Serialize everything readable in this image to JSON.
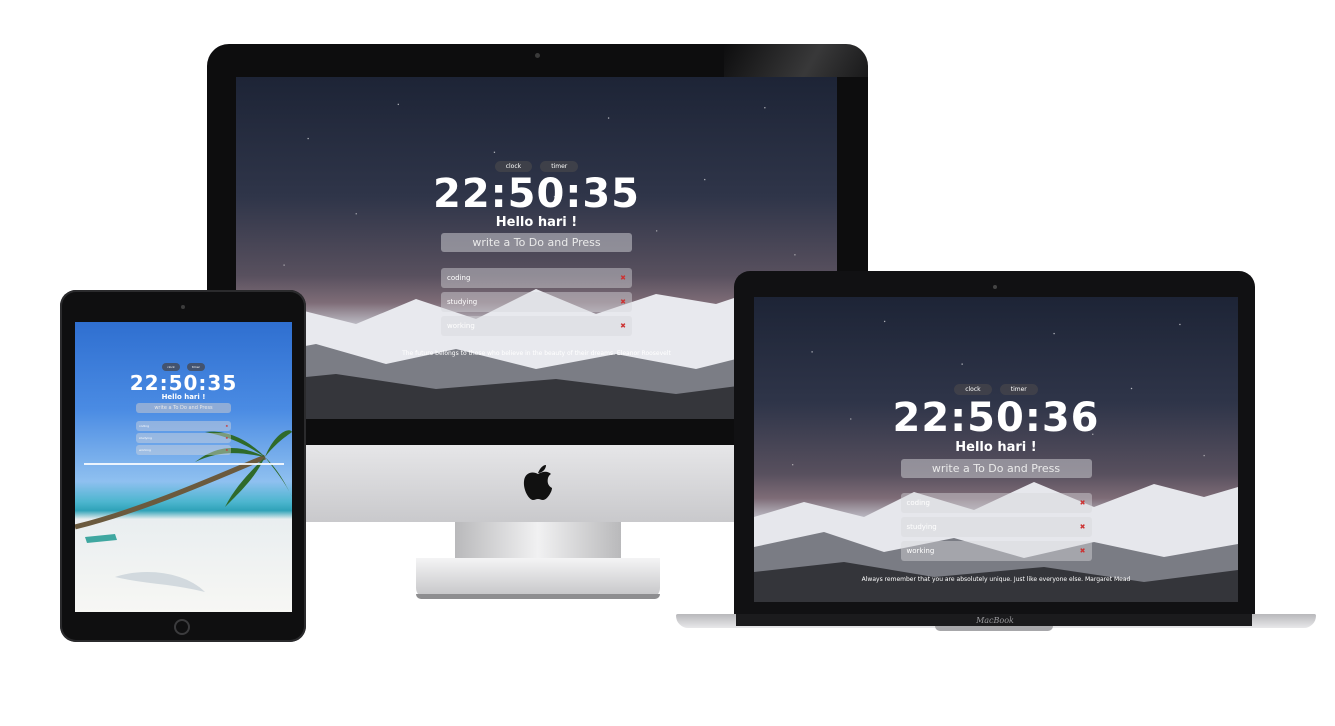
{
  "imac": {
    "toggle": {
      "clock_label": "clock",
      "timer_label": "timer"
    },
    "time": "22:50:35",
    "greeting": "Hello hari !",
    "input_placeholder": "write a To Do and Press",
    "todos": [
      {
        "text": "coding",
        "delete": "✖"
      },
      {
        "text": "studying",
        "delete": "✖"
      },
      {
        "text": "working",
        "delete": "✖"
      }
    ],
    "quote": "The future belongs to those who believe in the beauty of their dreams. Eleanor Roosevelt",
    "logo": ""
  },
  "laptop": {
    "toggle": {
      "clock_label": "clock",
      "timer_label": "timer"
    },
    "time": "22:50:36",
    "greeting": "Hello hari !",
    "input_placeholder": "write a To Do and Press",
    "todos": [
      {
        "text": "coding",
        "delete": "✖"
      },
      {
        "text": "studying",
        "delete": "✖"
      },
      {
        "text": "working",
        "delete": "✖"
      }
    ],
    "quote": "Always remember that you are absolutely unique. Just like everyone else. Margaret Mead",
    "brand": "MacBook"
  },
  "ipad": {
    "toggle": {
      "clock_label": "clock",
      "timer_label": "timer"
    },
    "time": "22:50:35",
    "greeting": "Hello hari !",
    "input_placeholder": "write a To Do and Press",
    "todos": [
      {
        "text": "coding",
        "delete": "✖"
      },
      {
        "text": "studying",
        "delete": "✖"
      },
      {
        "text": "working",
        "delete": "✖"
      }
    ]
  },
  "colors": {
    "delete_icon": "#cc3333",
    "pill_bg": "#46464b"
  }
}
